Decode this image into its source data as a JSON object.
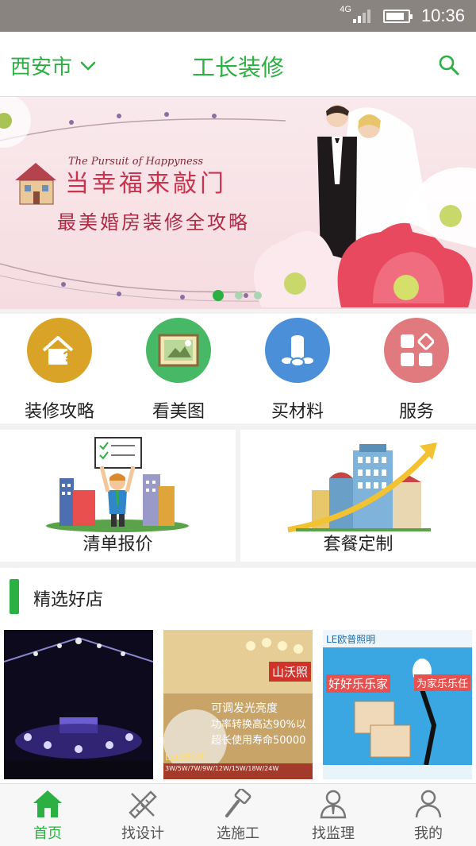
{
  "status_bar": {
    "network": "4G",
    "time": "10:36"
  },
  "header": {
    "city": "西安市",
    "title": "工长装修"
  },
  "banner": {
    "english_tagline": "The Pursuit of Happyness",
    "headline": "当幸福来敲门",
    "subheadline": "最美婚房装修全攻略",
    "slide_count": 3,
    "active_slide": 1
  },
  "quick_nav": [
    {
      "label": "装修攻略",
      "icon": "house-question-icon",
      "color": "#d9a328"
    },
    {
      "label": "看美图",
      "icon": "picture-frame-icon",
      "color": "#47b866"
    },
    {
      "label": "买材料",
      "icon": "material-rolls-icon",
      "color": "#4a8fd8"
    },
    {
      "label": "服务",
      "icon": "service-grid-icon",
      "color": "#e07a7e"
    }
  ],
  "feature_cards": [
    {
      "label": "清单报价",
      "icon": "checklist-city-illustration"
    },
    {
      "label": "套餐定制",
      "icon": "growth-city-illustration"
    }
  ],
  "section": {
    "title": "精选好店"
  },
  "stores": [
    {
      "name": "stage-venue-photo",
      "texts": []
    },
    {
      "name": "lighting-store-ad",
      "texts": [
        "山沃照",
        "可调发光亮度",
        "功率转换高达90%以",
        "超长使用寿命50000",
        "LED球泡灯",
        "3W/5W/7W/9W/12W/15W/18W/24W"
      ]
    },
    {
      "name": "lighting-brand-ad",
      "texts": [
        "LE欧普照明",
        "好好乐乐家",
        "为家乐乐任"
      ]
    }
  ],
  "tab_bar": [
    {
      "label": "首页",
      "icon": "home-icon",
      "active": true
    },
    {
      "label": "找设计",
      "icon": "design-ruler-icon",
      "active": false
    },
    {
      "label": "选施工",
      "icon": "hammer-icon",
      "active": false
    },
    {
      "label": "找监理",
      "icon": "supervisor-icon",
      "active": false
    },
    {
      "label": "我的",
      "icon": "user-icon",
      "active": false
    }
  ],
  "colors": {
    "brand": "#2db043",
    "status_bar": "#8a8480"
  }
}
